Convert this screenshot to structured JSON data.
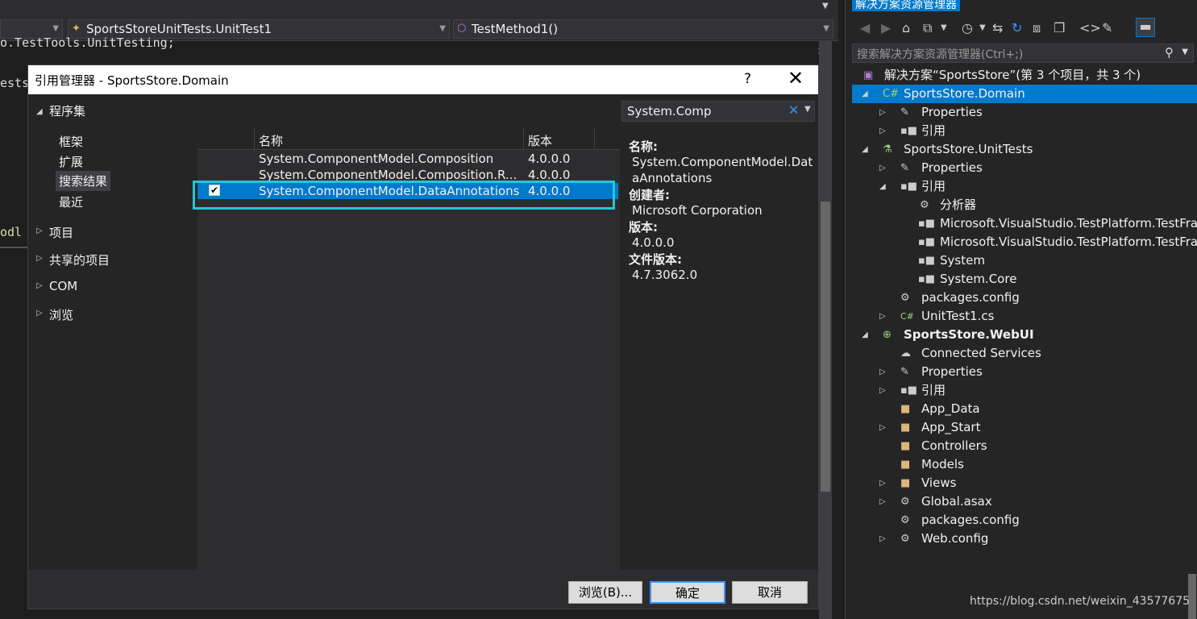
{
  "editor": {
    "nav_left": "",
    "nav_mid": "SportsStoreUnitTests.UnitTest1",
    "nav_right": "TestMethod1()",
    "code_lines": [
      "o.TestTools.UnitTesting;",
      "ests",
      "odl"
    ]
  },
  "dialog": {
    "title": "引用管理器 - SportsStore.Domain",
    "help": "?",
    "close": "✕",
    "nav": {
      "assemblies": "程序集",
      "framework": "框架",
      "extensions": "扩展",
      "search_results": "搜索结果",
      "recent": "最近",
      "projects": "项目",
      "shared_projects": "共享的项目",
      "com": "COM",
      "browse": "浏览"
    },
    "list": {
      "col_name": "名称",
      "col_version": "版本",
      "rows": [
        {
          "name": "System.ComponentModel.Composition",
          "version": "4.0.0.0",
          "checked": false
        },
        {
          "name": "System.ComponentModel.Composition.R...",
          "version": "4.0.0.0",
          "checked": false
        },
        {
          "name": "System.ComponentModel.DataAnnotations",
          "version": "4.0.0.0",
          "checked": true
        }
      ]
    },
    "search_value": "System.Comp",
    "details": {
      "name_label": "名称:",
      "name_value": "System.ComponentModel.DataAnnotations",
      "creator_label": "创建者:",
      "creator_value": "Microsoft Corporation",
      "version_label": "版本:",
      "version_value": "4.0.0.0",
      "file_version_label": "文件版本:",
      "file_version_value": "4.7.3062.0"
    },
    "buttons": {
      "browse": "浏览(B)...",
      "ok": "确定",
      "cancel": "取消"
    }
  },
  "solution_explorer": {
    "title": "解决方案资源管理器",
    "search_placeholder": "搜索解决方案资源管理器(Ctrl+;)",
    "tree": {
      "solution": "解决方案“SportsStore”(第 3 个项目，共 3 个)",
      "domain": "SportsStore.Domain",
      "domain_properties": "Properties",
      "domain_refs": "引用",
      "unittests": "SportsStore.UnitTests",
      "ut_properties": "Properties",
      "ut_refs": "引用",
      "analyzers": "分析器",
      "ref1": "Microsoft.VisualStudio.TestPlatform.TestFra",
      "ref2": "Microsoft.VisualStudio.TestPlatform.TestFra",
      "ref3": "System",
      "ref4": "System.Core",
      "ut_packages": "packages.config",
      "ut_unittest": "UnitTest1.cs",
      "webui": "SportsStore.WebUI",
      "connected": "Connected Services",
      "web_properties": "Properties",
      "web_refs": "引用",
      "app_data": "App_Data",
      "app_start": "App_Start",
      "controllers": "Controllers",
      "models": "Models",
      "views": "Views",
      "global": "Global.asax",
      "web_packages": "packages.config",
      "webconfig": "Web.config"
    }
  },
  "watermark": "https://blog.csdn.net/weixin_43577675"
}
